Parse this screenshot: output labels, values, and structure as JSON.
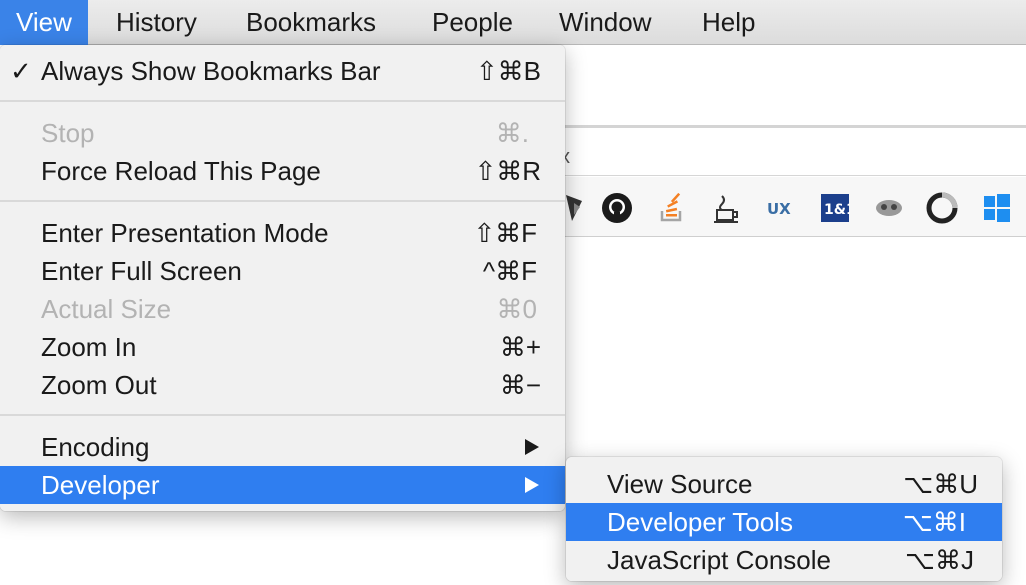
{
  "menubar": {
    "items": [
      {
        "label": "View",
        "active": true
      },
      {
        "label": "History"
      },
      {
        "label": "Bookmarks"
      },
      {
        "label": "People"
      },
      {
        "label": "Window"
      },
      {
        "label": "Help"
      }
    ]
  },
  "view_menu": {
    "items": {
      "always_show_bookmarks_bar": {
        "label": "Always Show Bookmarks Bar",
        "shortcut": "⇧⌘B",
        "checked": true
      },
      "stop": {
        "label": "Stop",
        "shortcut": "⌘.",
        "disabled": true
      },
      "force_reload": {
        "label": "Force Reload This Page",
        "shortcut": "⇧⌘R"
      },
      "presentation_mode": {
        "label": "Enter Presentation Mode",
        "shortcut": "⇧⌘F"
      },
      "full_screen": {
        "label": "Enter Full Screen",
        "shortcut": "^⌘F"
      },
      "actual_size": {
        "label": "Actual Size",
        "shortcut": "⌘0",
        "disabled": true
      },
      "zoom_in": {
        "label": "Zoom In",
        "shortcut": "⌘+"
      },
      "zoom_out": {
        "label": "Zoom Out",
        "shortcut": "⌘−"
      },
      "encoding": {
        "label": "Encoding",
        "submenu": true
      },
      "developer": {
        "label": "Developer",
        "submenu": true,
        "highlighted": true
      }
    }
  },
  "developer_submenu": {
    "items": {
      "view_source": {
        "label": "View Source",
        "shortcut": "⌥⌘U"
      },
      "developer_tools": {
        "label": "Developer Tools",
        "shortcut": "⌥⌘I",
        "highlighted": true
      },
      "javascript_console": {
        "label": "JavaScript Console",
        "shortcut": "⌥⌘J"
      }
    }
  },
  "browser": {
    "url_glyph": "x",
    "bookmark_icons": [
      "bookmark-icon",
      "github-icon",
      "stack-overflow-icon",
      "coffee-cup-icon",
      "ux-icon",
      "1and1-icon",
      "plugin-icon",
      "ring-icon",
      "windows-icon"
    ]
  },
  "colors": {
    "highlight": "#2f7ef0",
    "menubar_active": "#3a83e8",
    "disabled_text": "#b3b3b3"
  }
}
